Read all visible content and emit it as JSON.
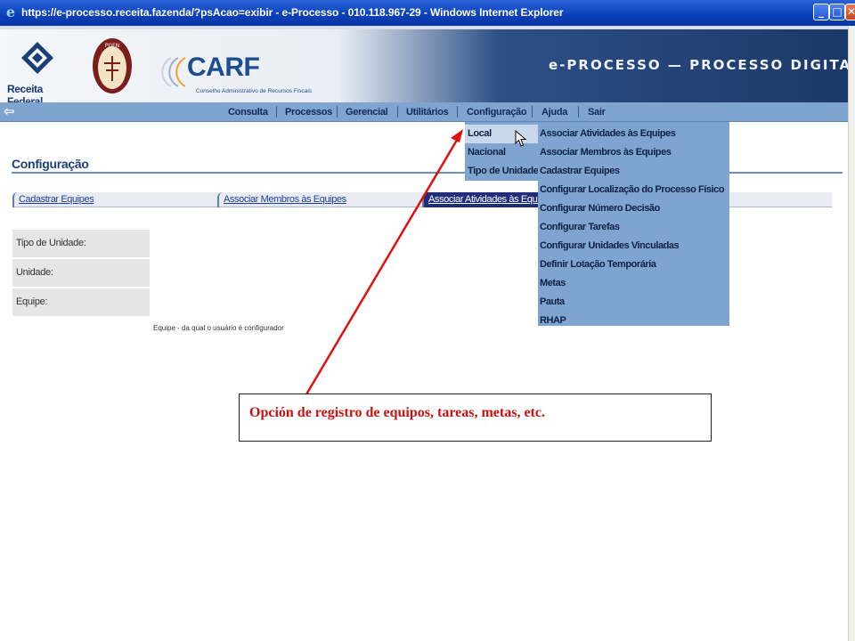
{
  "window": {
    "title": "https://e-processo.receita.fazenda/?psAcao=exibir - e-Processo - 010.118.967-29 - Windows Internet Explorer",
    "minimize": "_",
    "maximize": "□",
    "close": "✕"
  },
  "banner": {
    "receita_label": "Receita Federal",
    "pgfn_label": "PGFN",
    "carf_title": "CARF",
    "carf_subtitle": "Conselho Administrativo de Recursos Fiscais",
    "system_title": "e-PROCESSO — PROCESSO DIGITAL"
  },
  "nav": {
    "back_icon": "⇦",
    "items": [
      "Consulta",
      "Processos",
      "Gerencial",
      "Utilitários",
      "Configuração",
      "Ajuda",
      "Sair"
    ]
  },
  "page": {
    "title": "Configuração",
    "tabs": [
      "Cadastrar Equipes",
      "Associar Membros às Equipes",
      "Associar Atividades às Equip"
    ],
    "form_labels": [
      "Tipo de Unidade:",
      "Unidade:",
      "Equipe:"
    ],
    "equipe_note": "Equipe - da qual o usuário é configurador"
  },
  "menus": {
    "level1": [
      "Local",
      "Nacional",
      "Tipo de Unidade"
    ],
    "level2": [
      "Associar Atividades às Equipes",
      "Associar Membros às Equipes",
      "Cadastrar Equipes",
      "Configurar Localização do Processo Físico",
      "Configurar Número Decisão",
      "Configurar Tarefas",
      "Configurar Unidades Vinculadas",
      "Definir Lotação Temporária",
      "Metas",
      "Pauta",
      "RHAP"
    ]
  },
  "annotation": {
    "text": "Opción de registro de equipos, tareas, metas, etc.",
    "color": "#dd1111"
  },
  "colors": {
    "nav_bg": "#7ea4cf",
    "titlebar": "#0a3fb9",
    "page_title": "#1d3f77"
  }
}
